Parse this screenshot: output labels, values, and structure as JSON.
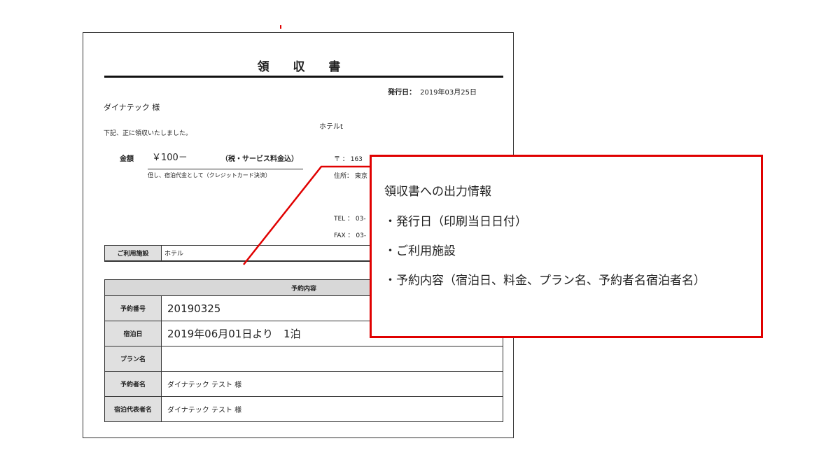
{
  "receipt": {
    "title": "領 収 書",
    "issue_label": "発行日：",
    "issue_date": "2019年03月25日",
    "recipient": "ダイナテック 様",
    "received_text": "下記、正に領収いたしました。",
    "hotel_name": "ホテルt",
    "amount_label": "金額",
    "amount_value": "￥100－",
    "tax_note": "（税・サービス料金込）",
    "proviso": "但し、宿泊代金として（クレジットカード決済）",
    "postal": "〒 ： 163",
    "address": "住所： 東京",
    "tel": "TEL ： 03-",
    "fax": "FAX ： 03-",
    "facility_label": "ご利用施設",
    "facility_value": "ホテル",
    "reservation_header": "予約内容",
    "rows": [
      {
        "label": "予約番号",
        "value": "20190325"
      },
      {
        "label": "宿泊日",
        "value": "2019年06月01日より　1泊"
      },
      {
        "label": "プラン名",
        "value": ""
      },
      {
        "label": "予約者名",
        "value": "ダイナテック テスト 様"
      },
      {
        "label": "宿泊代表者名",
        "value": "ダイナテック テスト 様"
      }
    ]
  },
  "callout": {
    "title": "領収書への出力情報",
    "items": [
      "・発行日（印刷当日日付）",
      "・ご利用施設",
      "・予約内容（宿泊日、料金、プラン名、予約者名宿泊者名）"
    ]
  },
  "colors": {
    "accent": "#e00000",
    "label_bg": "#e0e0e0",
    "header_bg": "#d8d8d8"
  }
}
